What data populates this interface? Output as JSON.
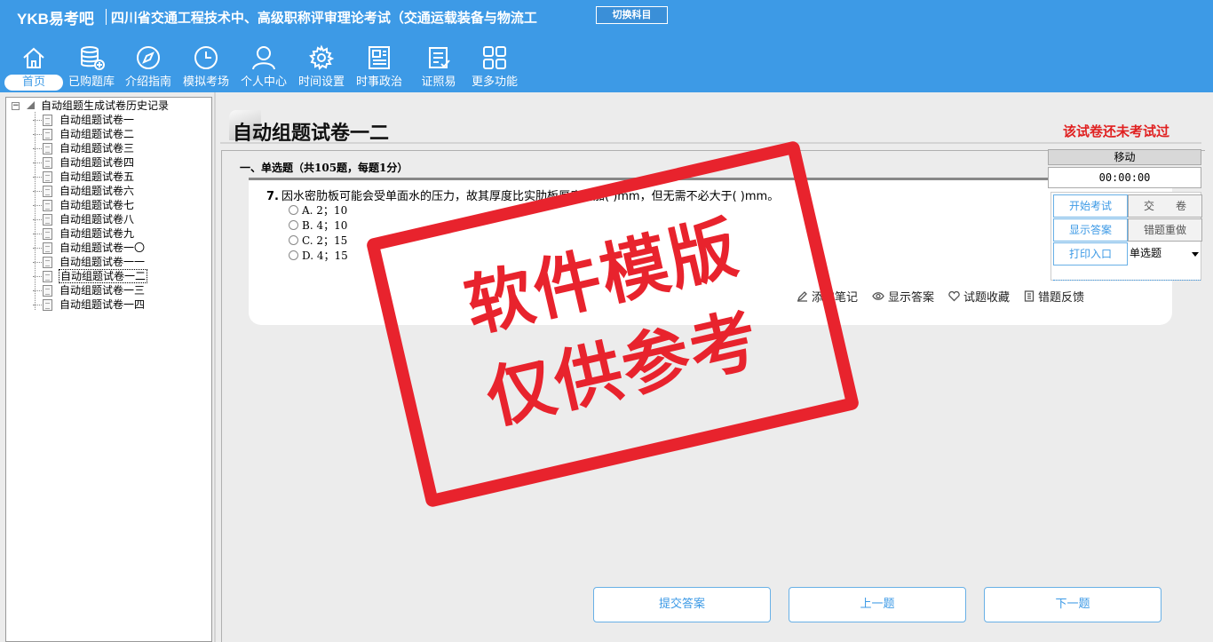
{
  "header": {
    "logo": "YKB易考吧",
    "course_title": "四川省交通工程技术中、高级职称评审理论考试（交通运载装备与物流工",
    "switch_subject_label": "切换科目"
  },
  "nav": [
    {
      "label": "首页",
      "icon": "home-icon"
    },
    {
      "label": "已购题库",
      "icon": "database-icon"
    },
    {
      "label": "介绍指南",
      "icon": "compass-icon"
    },
    {
      "label": "模拟考场",
      "icon": "clock-icon"
    },
    {
      "label": "个人中心",
      "icon": "user-icon"
    },
    {
      "label": "时间设置",
      "icon": "gear-icon"
    },
    {
      "label": "时事政治",
      "icon": "newspaper-icon"
    },
    {
      "label": "证照易",
      "icon": "checklist-icon"
    },
    {
      "label": "更多功能",
      "icon": "grid-icon"
    }
  ],
  "tree": {
    "root_label": "自动组题生成试卷历史记录",
    "items": [
      "自动组题试卷一",
      "自动组题试卷二",
      "自动组题试卷三",
      "自动组题试卷四",
      "自动组题试卷五",
      "自动组题试卷六",
      "自动组题试卷七",
      "自动组题试卷八",
      "自动组题试卷九",
      "自动组题试卷一〇",
      "自动组题试卷一一",
      "自动组题试卷一二",
      "自动组题试卷一三",
      "自动组题试卷一四"
    ],
    "selected": "自动组题试卷一二"
  },
  "exam": {
    "title": "自动组题试卷一二",
    "status": "该试卷还未考试过",
    "section_heading": "一、单选题（共105题，每题1分）"
  },
  "question": {
    "number": "7.",
    "text": "因水密肋板可能会受单面水的压力，故其厚度比实肋板厚度增加(  )mm，但无需不必大于(  )mm。",
    "options": [
      "A. 2；10",
      "B. 4；10",
      "C. 2；15",
      "D. 4；15"
    ],
    "tools": {
      "note": "添加笔记",
      "show_answer": "显示答案",
      "favorite": "试题收藏",
      "feedback": "错题反馈"
    }
  },
  "bottom_buttons": {
    "submit": "提交答案",
    "prev": "上一题",
    "next": "下一题"
  },
  "float_panel": {
    "move_label": "移动",
    "timer": "00:00:00",
    "start_exam": "开始考试",
    "submit_paper": "交　　卷",
    "show_answer": "显示答案",
    "redo_wrong": "错题重做",
    "print_entry": "打印入口",
    "question_type": "单选题"
  },
  "watermark": {
    "line1": "软件模版",
    "line2": "仅供参考"
  },
  "colors": {
    "header_bg": "#3d9ae6",
    "accent_blue": "#3d9ae6",
    "status_red": "#e02020",
    "stamp_red": "#e8232d"
  }
}
